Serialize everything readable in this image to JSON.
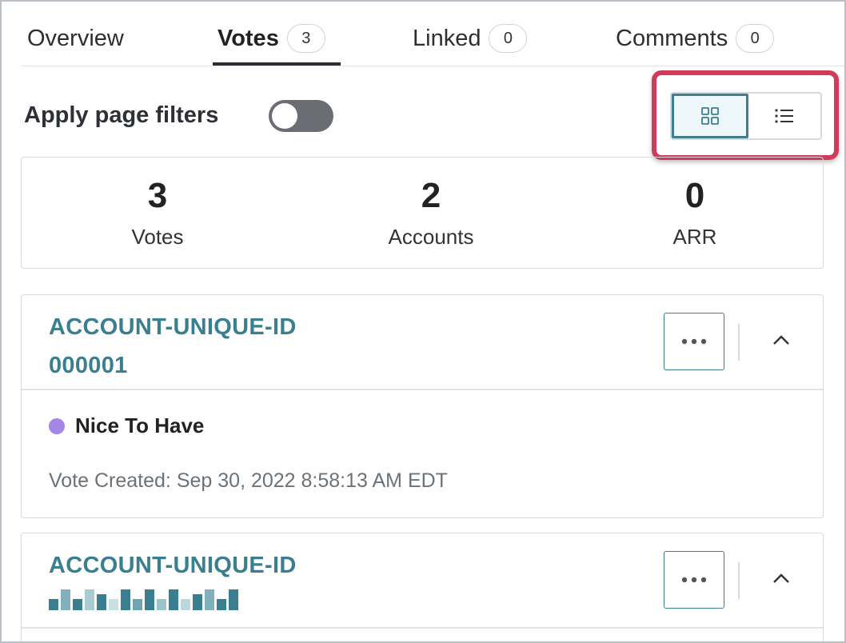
{
  "tabs": [
    {
      "label": "Overview",
      "count": null
    },
    {
      "label": "Votes",
      "count": "3"
    },
    {
      "label": "Linked",
      "count": "0"
    },
    {
      "label": "Comments",
      "count": "0"
    }
  ],
  "filters": {
    "apply_label": "Apply page filters",
    "apply_enabled": false
  },
  "view_switch": {
    "active": "grid",
    "options": [
      "grid-view-icon",
      "list-view-icon"
    ]
  },
  "summary": {
    "votes": {
      "value": "3",
      "label": "Votes"
    },
    "accounts": {
      "value": "2",
      "label": "Accounts"
    },
    "arr": {
      "value": "0",
      "label": "ARR"
    }
  },
  "cards": [
    {
      "title_line1": "ACCOUNT-UNIQUE-ID",
      "title_line2": "000001",
      "priority": "Nice To Have",
      "created": "Vote Created: Sep 30, 2022 8:58:13 AM EDT"
    },
    {
      "title_line1": "ACCOUNT-UNIQUE-ID",
      "title_line2": ""
    }
  ],
  "colors": {
    "accent": "#3d7f8e",
    "highlight": "#d23a5c",
    "priority_dot": "#a585e8",
    "toggle_off": "#6a6e74"
  }
}
